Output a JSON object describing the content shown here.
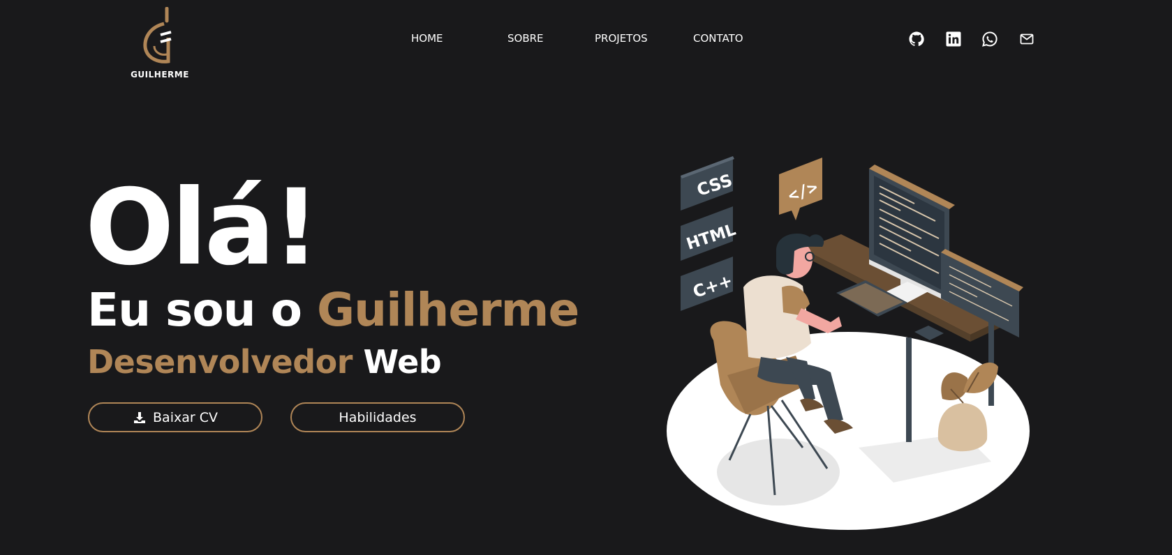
{
  "brand": {
    "logo_text": "GUILHERME",
    "logo_icon": "g-monogram-logo"
  },
  "nav": {
    "items": [
      {
        "label": "HOME"
      },
      {
        "label": "SOBRE"
      },
      {
        "label": "PROJETOS"
      },
      {
        "label": "CONTATO"
      }
    ]
  },
  "social": {
    "icons": [
      "github-icon",
      "linkedin-icon",
      "whatsapp-icon",
      "mail-icon"
    ]
  },
  "hero": {
    "greeting": "Olá!",
    "intro_prefix": "Eu sou o ",
    "name": "Guilherme",
    "role_accent": "Desenvolvedor",
    "role_rest": " Web",
    "buttons": {
      "cv": "Baixar CV",
      "skills": "Habilidades"
    }
  },
  "illustration": {
    "tags": [
      "CSS",
      "HTML",
      "C++"
    ],
    "code_bubble": "</>"
  },
  "colors": {
    "background": "#19191b",
    "accent": "#b08657",
    "text": "#ffffff"
  }
}
